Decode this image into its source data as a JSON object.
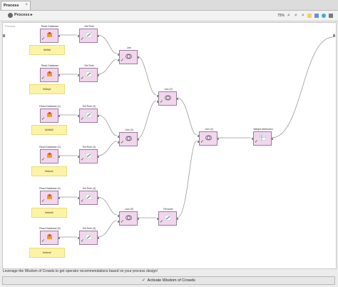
{
  "tab": {
    "label": "Process",
    "close": "×"
  },
  "toolbar": {
    "title": "Process ▸",
    "zoom": "75%"
  },
  "canvas": {
    "label": "Process"
  },
  "operators": [
    {
      "id": "rd1",
      "title": "Read Database"
    },
    {
      "id": "sr1",
      "title": "Set Role"
    },
    {
      "id": "rd2",
      "title": "Read Database"
    },
    {
      "id": "sr2",
      "title": "Set Role"
    },
    {
      "id": "j1",
      "title": "Join"
    },
    {
      "id": "j2",
      "title": "Join (2)"
    },
    {
      "id": "rd3",
      "title": "Read Database (2)"
    },
    {
      "id": "sr3",
      "title": "Set Role (2)"
    },
    {
      "id": "rd4",
      "title": "Read Database (3)"
    },
    {
      "id": "sr4",
      "title": "Set Role (3)"
    },
    {
      "id": "j3",
      "title": "Join (3)"
    },
    {
      "id": "j4",
      "title": "Join (4)"
    },
    {
      "id": "rd5",
      "title": "Read Database (4)"
    },
    {
      "id": "sr5",
      "title": "Set Role (4)"
    },
    {
      "id": "rd6",
      "title": "Read Database (5)"
    },
    {
      "id": "sr6",
      "title": "Set Role (5)"
    },
    {
      "id": "j5",
      "title": "Join (5)"
    },
    {
      "id": "ren",
      "title": "Rename"
    },
    {
      "id": "mi",
      "title": "Weight Attribution"
    }
  ],
  "notes": [
    "tbldfat",
    "tbldsp1",
    "tbldfat2",
    "tbldsn4",
    "tbldsh5",
    "tbldsn6"
  ],
  "footer": {
    "message": "Leverage the Wisdom of Crowds to get operator recommendations based on your process design!",
    "button": "Activate Wisdom of Crowds"
  }
}
